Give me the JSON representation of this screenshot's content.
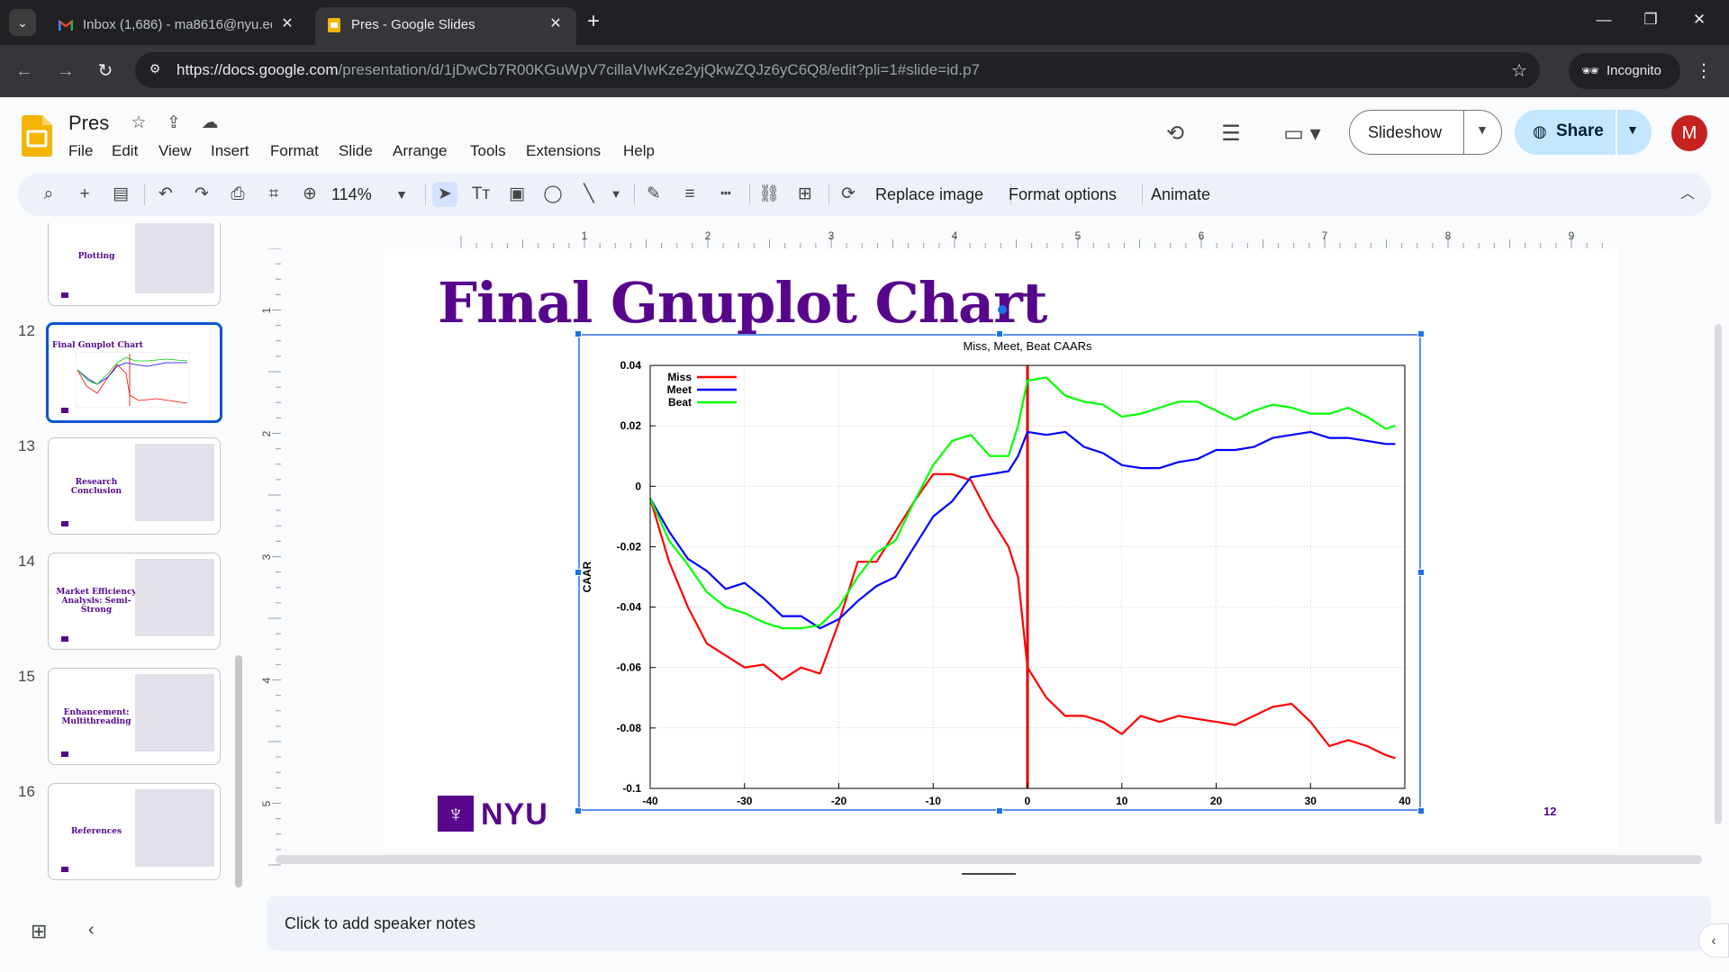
{
  "browser": {
    "tabs": [
      {
        "title": "Inbox (1,686) - ma8616@nyu.ed",
        "icon": "gmail-icon"
      },
      {
        "title": "Pres - Google Slides",
        "icon": "slides-icon",
        "active": true
      }
    ],
    "url_host": "https://docs.google.com",
    "url_path": "/presentation/d/1jDwCb7R00KGuWpV7cillaVIwKze2yjQkwZQJz6yC6Q8/edit?pli=1#slide=id.p7",
    "incognito_label": "Incognito"
  },
  "app": {
    "doc_title": "Pres",
    "menu": [
      "File",
      "Edit",
      "View",
      "Insert",
      "Format",
      "Slide",
      "Arrange",
      "Tools",
      "Extensions",
      "Help"
    ],
    "slideshow_label": "Slideshow",
    "share_label": "Share",
    "avatar_letter": "M",
    "accent_color": "#57068c",
    "share_color": "#c2e7ff"
  },
  "toolbar": {
    "zoom": "114%",
    "replace_image": "Replace image",
    "format_options": "Format options",
    "animate": "Animate"
  },
  "filmstrip": [
    {
      "num": "",
      "title": "Plotting"
    },
    {
      "num": "12",
      "title": "Final Gnuplot Chart",
      "selected": true
    },
    {
      "num": "13",
      "title": "Research Conclusion"
    },
    {
      "num": "14",
      "title": "Market Efficiency Analysis: Semi-Strong"
    },
    {
      "num": "15",
      "title": "Enhancement: Multithreading"
    },
    {
      "num": "16",
      "title": "References"
    }
  ],
  "ruler": {
    "h_ticks": [
      "1",
      "2",
      "3",
      "4",
      "5",
      "6",
      "7",
      "8",
      "9"
    ],
    "v_ticks": [
      "1",
      "2",
      "3",
      "4",
      "5"
    ]
  },
  "slide": {
    "title": "Final Gnuplot Chart",
    "logo_text": "NYU",
    "page_number": "12"
  },
  "notes_placeholder": "Click to add speaker notes",
  "chart_data": {
    "type": "line",
    "title": "Miss, Meet, Beat CAARs",
    "xlabel": "",
    "ylabel": "CAAR",
    "xlim": [
      -40,
      40
    ],
    "ylim": [
      -0.1,
      0.04
    ],
    "x_ticks": [
      "-40",
      "-30",
      "-20",
      "-10",
      "0",
      "10",
      "20",
      "30",
      "40"
    ],
    "y_ticks": [
      "0.04",
      "0.02",
      "0",
      "-0.02",
      "-0.04",
      "-0.06",
      "-0.08",
      "-0.1"
    ],
    "grid": true,
    "legend_position": "top-left",
    "vertical_line_x": 0,
    "x": [
      -40,
      -38,
      -36,
      -34,
      -32,
      -30,
      -28,
      -26,
      -24,
      -22,
      -20,
      -18,
      -16,
      -14,
      -12,
      -10,
      -8,
      -6,
      -4,
      -2,
      -1,
      0,
      2,
      4,
      6,
      8,
      10,
      12,
      14,
      16,
      18,
      20,
      22,
      24,
      26,
      28,
      30,
      32,
      34,
      36,
      38,
      39
    ],
    "series": [
      {
        "name": "Miss",
        "color": "#ff0000",
        "values": [
          -0.004,
          -0.025,
          -0.04,
          -0.052,
          -0.056,
          -0.06,
          -0.059,
          -0.064,
          -0.06,
          -0.062,
          -0.045,
          -0.025,
          -0.025,
          -0.015,
          -0.005,
          0.004,
          0.004,
          0.002,
          -0.01,
          -0.02,
          -0.03,
          -0.06,
          -0.07,
          -0.076,
          -0.076,
          -0.078,
          -0.082,
          -0.076,
          -0.078,
          -0.076,
          -0.077,
          -0.078,
          -0.079,
          -0.076,
          -0.073,
          -0.072,
          -0.078,
          -0.086,
          -0.084,
          -0.086,
          -0.089,
          -0.09
        ]
      },
      {
        "name": "Meet",
        "color": "#0000ff",
        "values": [
          -0.004,
          -0.015,
          -0.024,
          -0.028,
          -0.034,
          -0.032,
          -0.037,
          -0.043,
          -0.043,
          -0.047,
          -0.044,
          -0.038,
          -0.033,
          -0.03,
          -0.02,
          -0.01,
          -0.005,
          0.003,
          0.004,
          0.005,
          0.01,
          0.018,
          0.017,
          0.018,
          0.013,
          0.011,
          0.007,
          0.006,
          0.006,
          0.008,
          0.009,
          0.012,
          0.012,
          0.013,
          0.016,
          0.017,
          0.018,
          0.016,
          0.016,
          0.015,
          0.014,
          0.014
        ]
      },
      {
        "name": "Beat",
        "color": "#00ff00",
        "values": [
          -0.004,
          -0.018,
          -0.026,
          -0.035,
          -0.04,
          -0.042,
          -0.045,
          -0.047,
          -0.047,
          -0.046,
          -0.04,
          -0.03,
          -0.022,
          -0.018,
          -0.005,
          0.007,
          0.015,
          0.017,
          0.01,
          0.01,
          0.02,
          0.035,
          0.036,
          0.03,
          0.028,
          0.027,
          0.023,
          0.024,
          0.026,
          0.028,
          0.028,
          0.025,
          0.022,
          0.025,
          0.027,
          0.026,
          0.024,
          0.024,
          0.026,
          0.023,
          0.019,
          0.02
        ]
      }
    ]
  }
}
